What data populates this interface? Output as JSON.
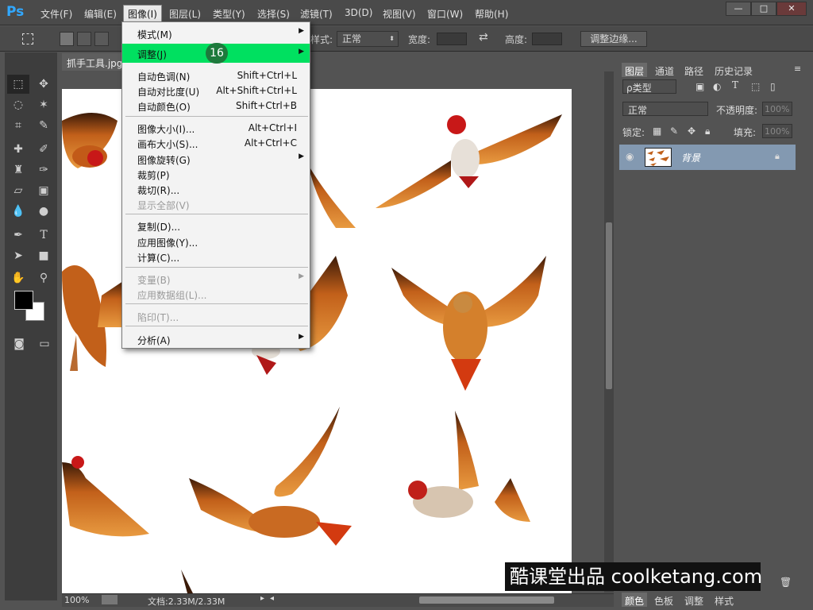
{
  "app": {
    "logo": "Ps"
  },
  "menubar": {
    "items": [
      "文件(F)",
      "编辑(E)",
      "图像(I)",
      "图层(L)",
      "类型(Y)",
      "选择(S)",
      "滤镜(T)",
      "3D(D)",
      "视图(V)",
      "窗口(W)",
      "帮助(H)"
    ],
    "active": "图像(I)"
  },
  "window_controls": {
    "minimize": "—",
    "maximize": "□",
    "close": "✕"
  },
  "options_bar": {
    "style_label": "样式:",
    "style_value": "正常",
    "width_label": "宽度:",
    "height_label": "高度:",
    "refine_edge": "调整边缘..."
  },
  "document": {
    "tab_title": "抓手工具.jpg",
    "zoom": "100%",
    "doc_info": "文档:2.33M/2.33M"
  },
  "dropdown": {
    "items": [
      {
        "label": "模式(M)",
        "shortcut": "",
        "submenu": true,
        "disabled": false
      },
      {
        "label": "调整(J)",
        "shortcut": "",
        "submenu": true,
        "disabled": false,
        "highlighted": true
      },
      {
        "label": "自动色调(N)",
        "shortcut": "Shift+Ctrl+L",
        "submenu": false,
        "disabled": false
      },
      {
        "label": "自动对比度(U)",
        "shortcut": "Alt+Shift+Ctrl+L",
        "submenu": false,
        "disabled": false
      },
      {
        "label": "自动颜色(O)",
        "shortcut": "Shift+Ctrl+B",
        "submenu": false,
        "disabled": false
      },
      {
        "label": "图像大小(I)...",
        "shortcut": "Alt+Ctrl+I",
        "submenu": false,
        "disabled": false
      },
      {
        "label": "画布大小(S)...",
        "shortcut": "Alt+Ctrl+C",
        "submenu": false,
        "disabled": false
      },
      {
        "label": "图像旋转(G)",
        "shortcut": "",
        "submenu": true,
        "disabled": false
      },
      {
        "label": "裁剪(P)",
        "shortcut": "",
        "submenu": false,
        "disabled": false
      },
      {
        "label": "裁切(R)...",
        "shortcut": "",
        "submenu": false,
        "disabled": false
      },
      {
        "label": "显示全部(V)",
        "shortcut": "",
        "submenu": false,
        "disabled": true
      },
      {
        "label": "复制(D)...",
        "shortcut": "",
        "submenu": false,
        "disabled": false
      },
      {
        "label": "应用图像(Y)...",
        "shortcut": "",
        "submenu": false,
        "disabled": false
      },
      {
        "label": "计算(C)...",
        "shortcut": "",
        "submenu": false,
        "disabled": false
      },
      {
        "label": "变量(B)",
        "shortcut": "",
        "submenu": true,
        "disabled": true
      },
      {
        "label": "应用数据组(L)...",
        "shortcut": "",
        "submenu": false,
        "disabled": true
      },
      {
        "label": "陷印(T)...",
        "shortcut": "",
        "submenu": false,
        "disabled": true
      },
      {
        "label": "分析(A)",
        "shortcut": "",
        "submenu": true,
        "disabled": false
      }
    ],
    "step_badge": "16"
  },
  "panels": {
    "tabs": [
      "图层",
      "通道",
      "路径",
      "历史记录"
    ],
    "filter_kind": "ρ类型",
    "blend_mode": "正常",
    "opacity_label": "不透明度:",
    "opacity_value": "100%",
    "lock_label": "锁定:",
    "fill_label": "填充:",
    "fill_value": "100%",
    "layer_name": "背景",
    "bottom_tabs": [
      "颜色",
      "色板",
      "调整",
      "样式"
    ]
  },
  "watermark": "酷课堂出品 coolketang.com",
  "colors": {
    "highlight": "#00e060",
    "badge": "#1d7a3c",
    "layer_selected": "#8399b1"
  }
}
